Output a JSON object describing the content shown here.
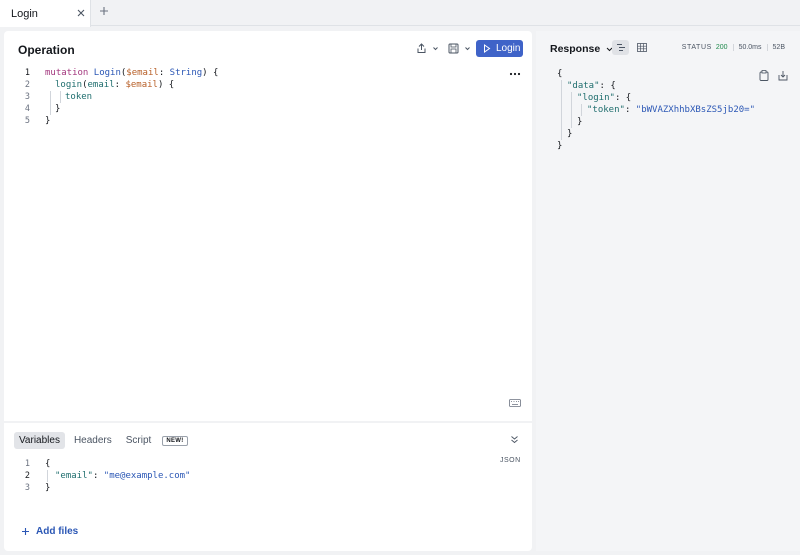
{
  "tabs": [
    {
      "label": "Login"
    }
  ],
  "operation": {
    "title": "Operation",
    "run_label": "Login",
    "lines": [
      "1",
      "2",
      "3",
      "4",
      "5"
    ],
    "code": {
      "l1": {
        "kw": "mutation",
        "name": "Login",
        "open": "(",
        "var": "$email",
        "colon": ":",
        "type": "String",
        "close": ") {"
      },
      "l2": {
        "field": "login",
        "open": "(",
        "arg": "email",
        "colon": ":",
        "var": "$email",
        "close": ") {"
      },
      "l3": {
        "field": "token"
      },
      "l4": "}",
      "l5": "}"
    }
  },
  "variables": {
    "tabs": [
      "Variables",
      "Headers",
      "Script"
    ],
    "new_badge": "NEW!",
    "format_label": "JSON",
    "lines": [
      "1",
      "2",
      "3"
    ],
    "json": {
      "open": "{",
      "key": "\"email\"",
      "colon": ":",
      "value": "\"me@example.com\"",
      "close": "}"
    },
    "add_files_label": "Add files"
  },
  "response": {
    "title": "Response",
    "status_label": "STATUS",
    "status_code": "200",
    "time": "50.0ms",
    "size": "52B",
    "json": {
      "open": "{",
      "data_key": "\"data\"",
      "login_key": "\"login\"",
      "token_key": "\"token\"",
      "token_value": "\"bWVAZXhhbXBsZS5jb20=\"",
      "colon": ":",
      "brace_open": "{",
      "brace_close": "}",
      "close": "}"
    }
  },
  "colors": {
    "accent": "#3f63c8",
    "status_ok": "#1f8a4c"
  },
  "icons": [
    "close-icon",
    "plus-icon",
    "share-icon",
    "save-icon",
    "play-icon",
    "more-icon",
    "keyboard-icon",
    "collapse-icon",
    "chevron-down-icon",
    "json-view-icon",
    "table-view-icon",
    "copy-icon",
    "download-icon"
  ]
}
